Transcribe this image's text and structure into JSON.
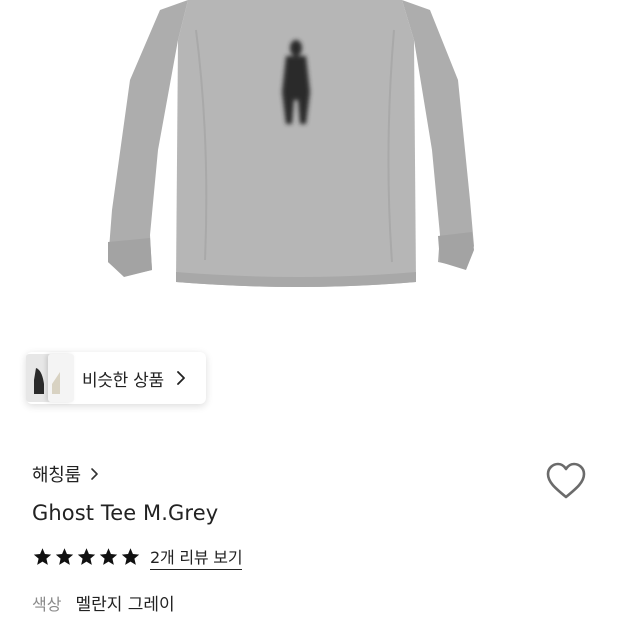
{
  "similar": {
    "label": "비슷한 상품"
  },
  "brand": {
    "name": "해칭룸"
  },
  "product": {
    "title": "Ghost Tee M.Grey",
    "rating_stars": 5,
    "review_link": "2개 리뷰 보기"
  },
  "option": {
    "label": "색상",
    "value": "멜란지 그레이"
  },
  "colors": {
    "shirt": "#b4b4b4",
    "print": "#2b2b2b",
    "star": "#111111"
  },
  "icons": {
    "similar_chevron": "chevron-right-icon",
    "brand_chevron": "chevron-right-icon",
    "wishlist": "heart-outline-icon",
    "rating": "star-filled-icon"
  }
}
